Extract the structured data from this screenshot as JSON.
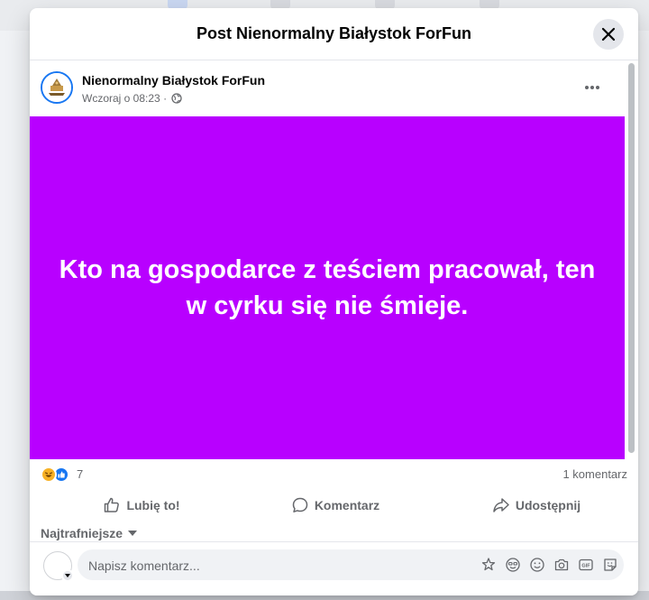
{
  "modal": {
    "title": "Post Nienormalny Białystok ForFun",
    "close_icon": "close-icon"
  },
  "post": {
    "author": "Nienormalny Białystok ForFun",
    "time": "Wczoraj o 08:23",
    "separator": "·",
    "privacy_icon": "globe-icon",
    "text": "Kto na gospodarce z teściem pracował, ten w cyrku się nie śmieje.",
    "background_color": "#b800ff"
  },
  "stats": {
    "reaction_count": "7",
    "reactions": [
      "haha-reaction-icon",
      "like-reaction-icon"
    ],
    "comment_count": "1 komentarz"
  },
  "actions": {
    "like": "Lubię to!",
    "comment": "Komentarz",
    "share": "Udostępnij"
  },
  "comments": {
    "sort_label": "Najtrafniejsze"
  },
  "composer": {
    "placeholder": "Napisz komentarz...",
    "tools": [
      "avatar-sticker-icon",
      "emoji-face-icon",
      "smile-icon",
      "camera-icon",
      "gif-icon",
      "sticker-icon"
    ]
  },
  "colors": {
    "accent": "#1877f2",
    "secondary_text": "#65676b"
  }
}
